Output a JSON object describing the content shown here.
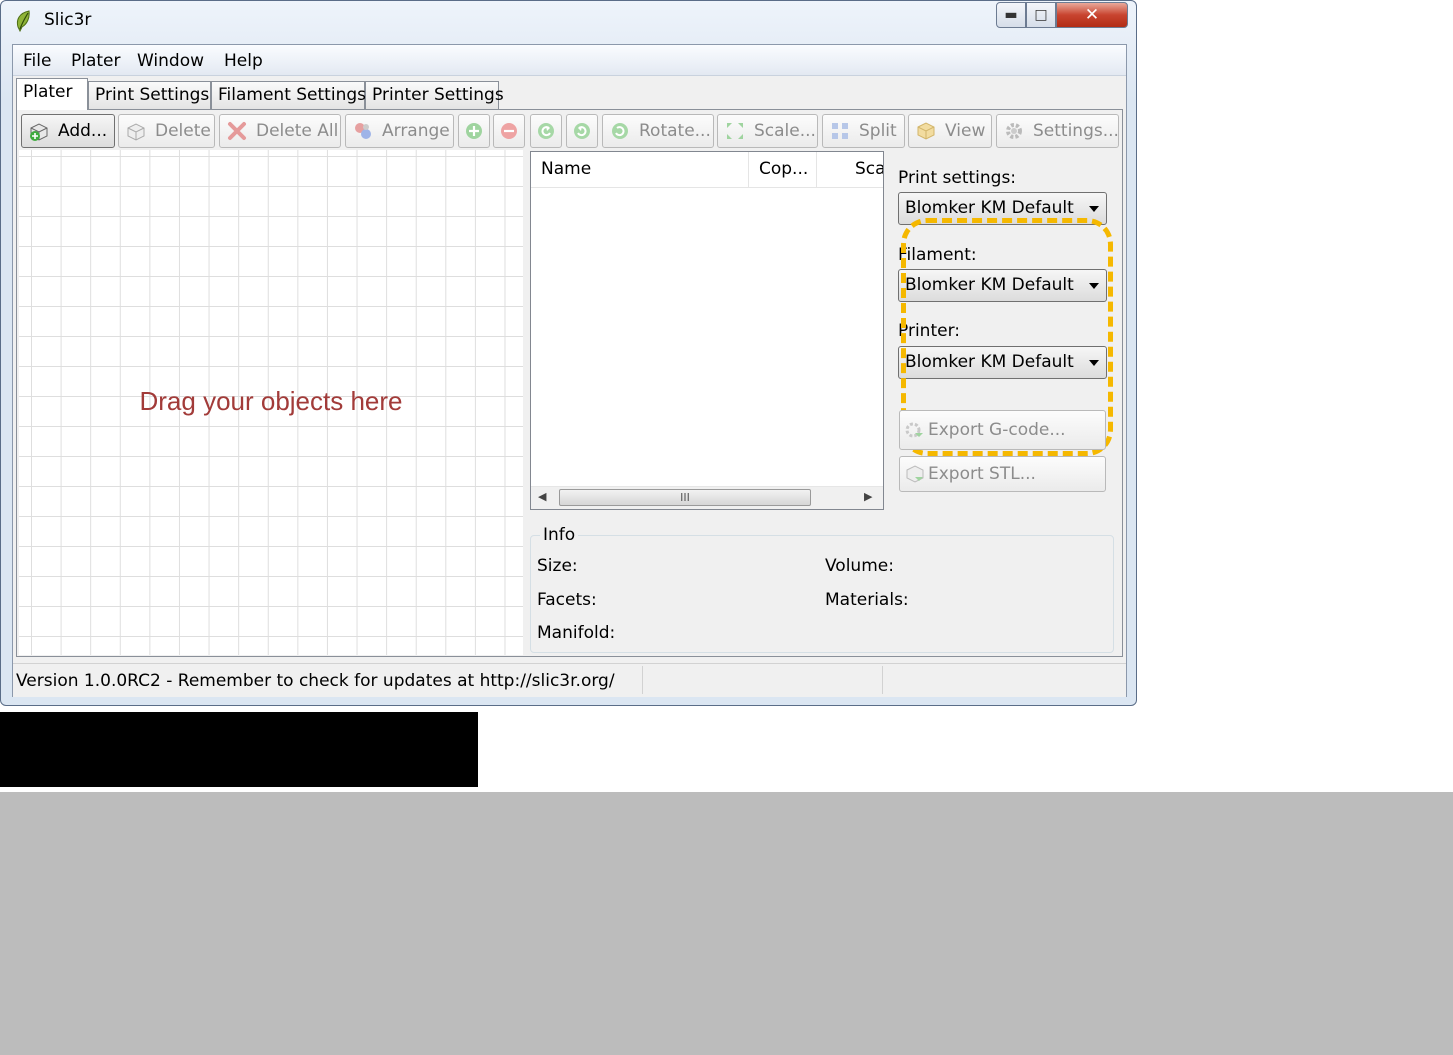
{
  "window": {
    "title": "Slic3r"
  },
  "menu": [
    "File",
    "Plater",
    "Window",
    "Help"
  ],
  "tabs": [
    "Plater",
    "Print Settings",
    "Filament Settings",
    "Printer Settings"
  ],
  "toolbar": {
    "add": "Add...",
    "delete": "Delete",
    "delete_all": "Delete All",
    "arrange": "Arrange",
    "rotate": "Rotate...",
    "scale": "Scale...",
    "split": "Split",
    "view": "View",
    "settings": "Settings..."
  },
  "canvas": {
    "hint": "Drag your objects here"
  },
  "object_list": {
    "columns": [
      "Name",
      "Cop...",
      "Sca"
    ],
    "scroll_thumb": "III"
  },
  "presets": {
    "print_label": "Print settings:",
    "print_value": "Blomker KM Default",
    "filament_label": "Filament:",
    "filament_value": "Blomker KM Default",
    "printer_label": "Printer:",
    "printer_value": "Blomker KM Default",
    "highlight_color": "#f5b800"
  },
  "actions": {
    "export_gcode": "Export G-code...",
    "export_stl": "Export STL..."
  },
  "info": {
    "title": "Info",
    "size": "Size:",
    "volume": "Volume:",
    "facets": "Facets:",
    "materials": "Materials:",
    "manifold": "Manifold:"
  },
  "status": "Version 1.0.0RC2 - Remember to check for updates at http://slic3r.org/"
}
